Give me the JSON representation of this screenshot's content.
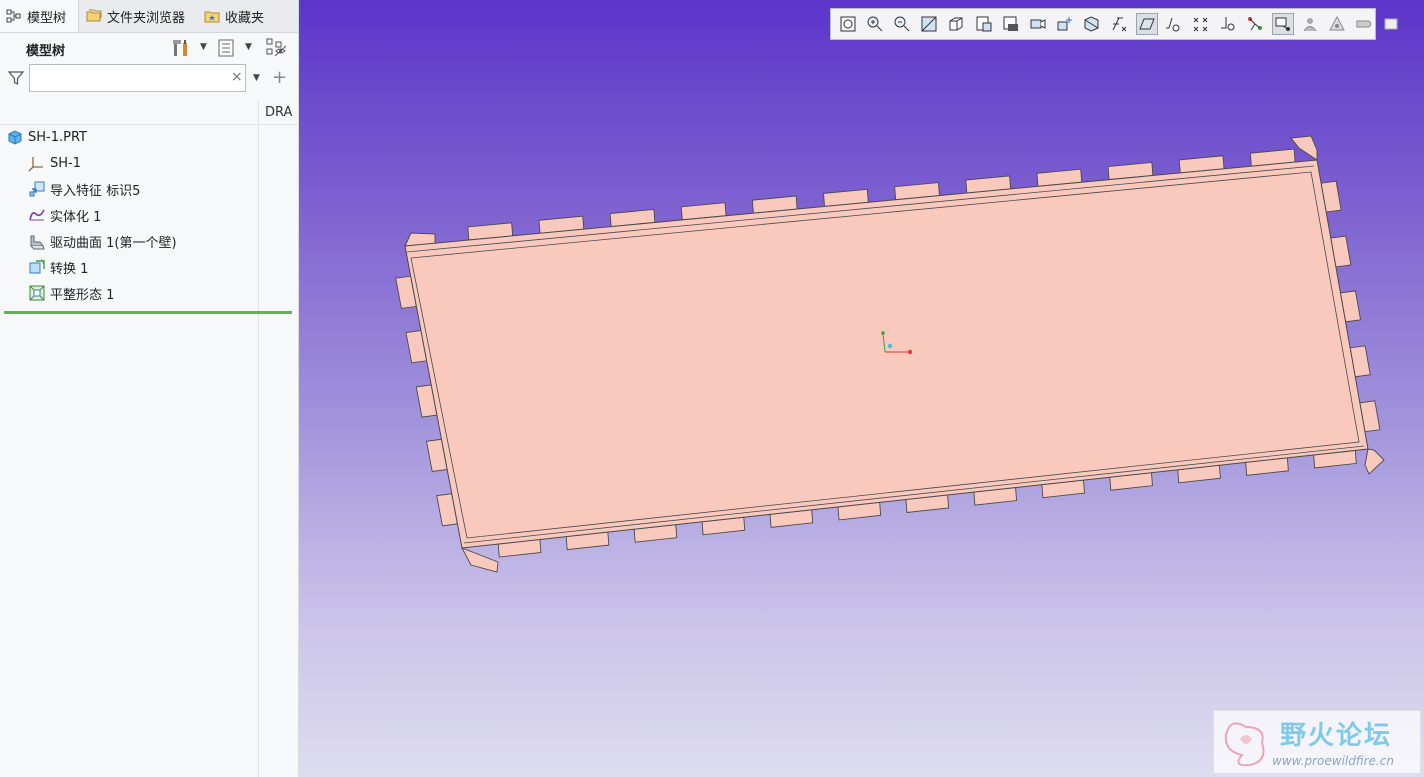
{
  "tabs": [
    {
      "label": "模型树",
      "icon": "model-tree-icon"
    },
    {
      "label": "文件夹浏览器",
      "icon": "folder-browser-icon"
    },
    {
      "label": "收藏夹",
      "icon": "favorites-icon"
    }
  ],
  "panel": {
    "title": "模型树",
    "settings_icon": "tree-settings-icon",
    "columns_icon": "tree-columns-icon",
    "display_icon": "tree-display-icon"
  },
  "search": {
    "value": "",
    "placeholder": "",
    "clear": "×",
    "add": "+"
  },
  "columns": {
    "dra": "DRA"
  },
  "tree": {
    "root": {
      "label": "SH-1.PRT",
      "icon": "part-icon"
    },
    "items": [
      {
        "label": "SH-1",
        "icon": "coordinate-system-icon"
      },
      {
        "label": "导入特征 标识5",
        "icon": "import-feature-icon"
      },
      {
        "label": "实体化 1",
        "icon": "solidify-icon"
      },
      {
        "label": "驱动曲面 1(第一个壁)",
        "icon": "driving-surface-icon"
      },
      {
        "label": "转换 1",
        "icon": "conversion-icon"
      },
      {
        "label": "平整形态 1",
        "icon": "flat-state-icon"
      }
    ]
  },
  "toolbar": {
    "buttons": [
      "refit-icon",
      "zoom-in-icon",
      "zoom-out-icon",
      "repaint-icon",
      "display-style-icon",
      "saved-orientations-icon",
      "view-manager-icon",
      "named-views-icon",
      "perspective-icon",
      "section-icon",
      "datum-display-icon",
      "annotation-display-icon",
      "plane-display-icon",
      "axis-display-icon",
      "point-display-icon",
      "csys-display-icon",
      "spin-center-icon",
      "annotation-filter-icon",
      "appearance-icon",
      "render-icon",
      "flat-pattern-preview-icon"
    ],
    "active": [
      "annotation-display-icon",
      "spin-center-icon"
    ]
  },
  "watermark": {
    "title": "野火论坛",
    "url": "www.proewildfire.cn"
  },
  "colors": {
    "part_fill": "#f9c9bd",
    "part_edge": "#4a4a4a",
    "viewport_top": "#5b35c9",
    "viewport_bottom": "#dedcf0",
    "insert_line": "#5cb84a"
  }
}
